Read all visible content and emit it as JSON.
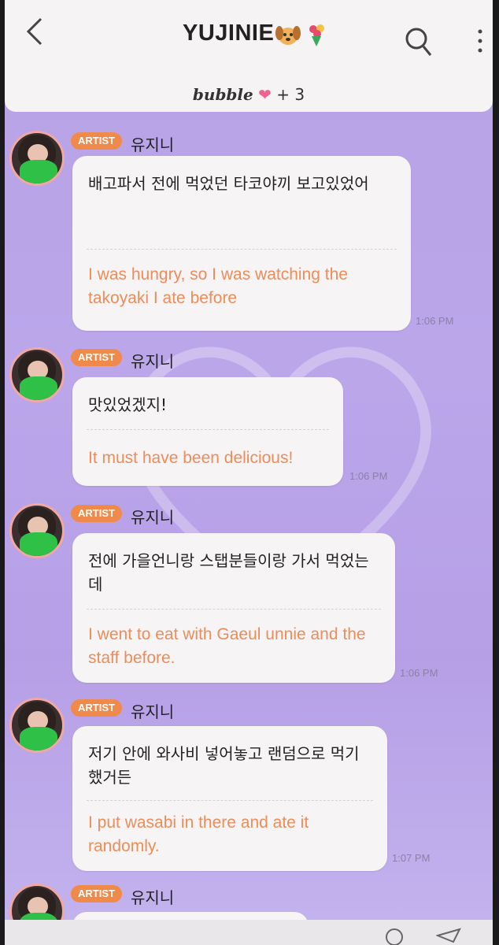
{
  "header": {
    "title": "YUJINIE",
    "title_emojis": [
      "dog-face-emoji",
      "bouquet-emoji"
    ],
    "brand": "bubble",
    "member_count": "+ 3"
  },
  "colors": {
    "background": "#b9a3e7",
    "badge": "#f08a4b",
    "translation_text": "#ee8c5a",
    "avatar_ring": "#f0a8a4"
  },
  "messages": [
    {
      "badge": "ARTIST",
      "sender": "유지니",
      "korean": "배고파서 전에 먹었던 타코야끼 보고있었어",
      "english": "I was hungry, so I was watching the takoyaki I ate before",
      "time": "1:06 PM"
    },
    {
      "badge": "ARTIST",
      "sender": "유지니",
      "korean": "맛있었겠지!",
      "english": "It must have been delicious!",
      "time": "1:06 PM"
    },
    {
      "badge": "ARTIST",
      "sender": "유지니",
      "korean": "전에 가을언니랑 스탭분들이랑 가서 먹었는데",
      "english": "I went to eat with Gaeul unnie and the staff before.",
      "time": "1:06 PM"
    },
    {
      "badge": "ARTIST",
      "sender": "유지니",
      "korean": "저기 안에 와사비 넣어놓고 랜덤으로 먹기 했거든",
      "english": "I put wasabi in there and ate it randomly.",
      "time": "1:07 PM"
    },
    {
      "badge": "ARTIST",
      "sender": "유지니"
    }
  ]
}
